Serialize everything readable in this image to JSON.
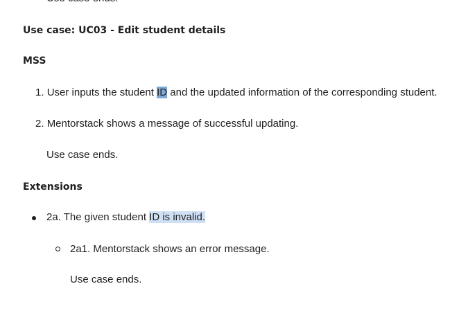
{
  "clipped_text": "Use case ends.",
  "use_case": {
    "heading": "Use case: UC03 - Edit student details"
  },
  "mss": {
    "heading": "MSS",
    "steps": [
      {
        "number": "1.",
        "before": "User inputs the student ",
        "highlight": "ID",
        "after": " and the updated information of the corresponding student."
      },
      {
        "number": "2.",
        "text": "Mentorstack shows a message of successful updating."
      }
    ],
    "end_text": "Use case ends."
  },
  "extensions": {
    "heading": "Extensions",
    "items": [
      {
        "before": "2a. The given student ",
        "highlight": "ID is invalid.",
        "sub_items": [
          {
            "text": "2a1. Mentorstack shows an error message."
          }
        ],
        "end_text": "Use case ends."
      }
    ]
  },
  "colors": {
    "selection_strong": "#7fa9d6",
    "selection_soft": "#cfe0f5",
    "text": "#1f1f1f"
  }
}
